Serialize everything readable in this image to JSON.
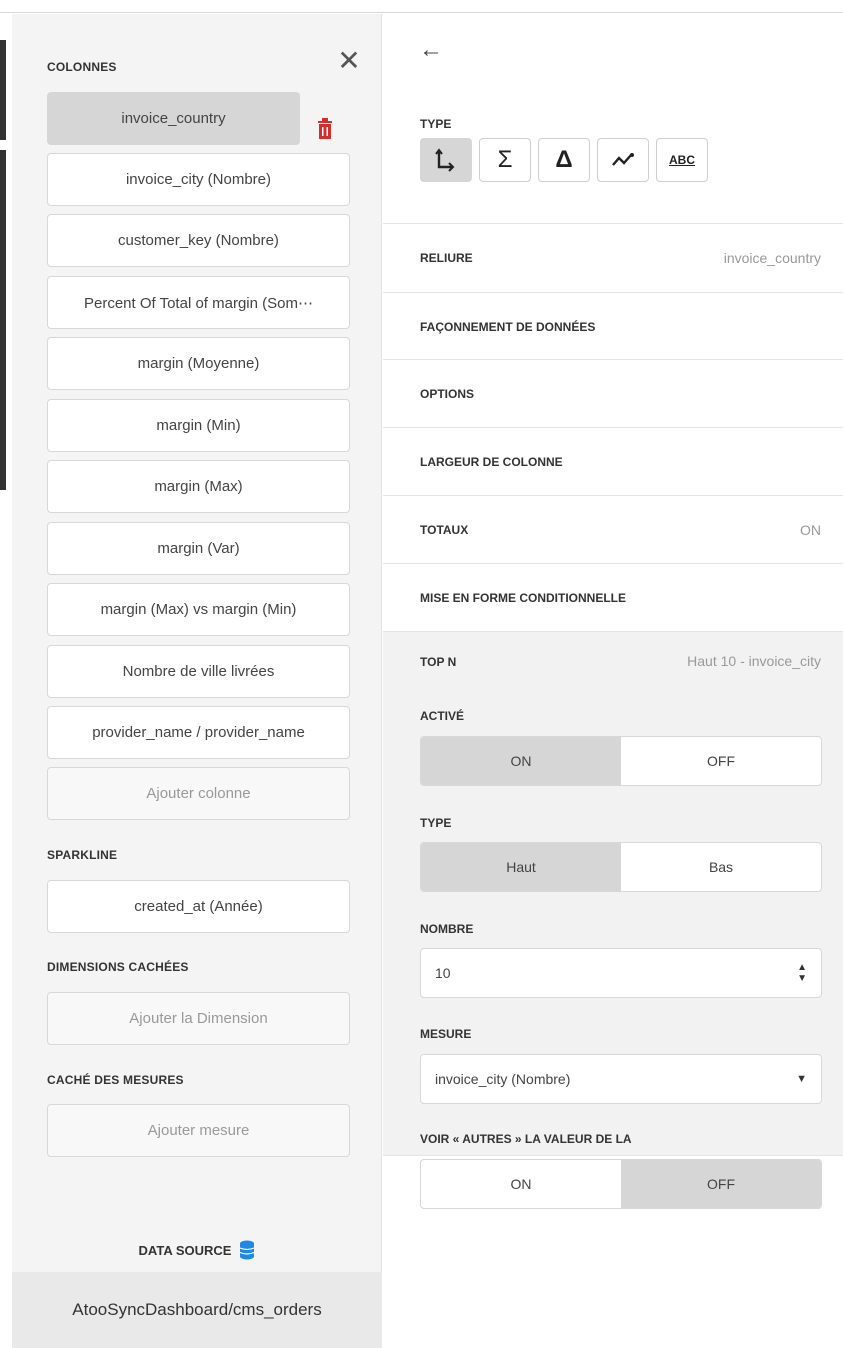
{
  "left": {
    "colonnes_label": "COLONNES",
    "columns": [
      "invoice_country",
      "invoice_city (Nombre)",
      "customer_key (Nombre)",
      "Percent Of Total of margin (Som⋯",
      "margin (Moyenne)",
      "margin (Min)",
      "margin (Max)",
      "margin (Var)",
      "margin (Max) vs margin (Min)",
      "Nombre de ville livrées",
      "provider_name / provider_name"
    ],
    "add_column": "Ajouter colonne",
    "sparkline_label": "SPARKLINE",
    "sparkline_value": "created_at (Année)",
    "hidden_dims_label": "DIMENSIONS CACHÉES",
    "add_dimension": "Ajouter la Dimension",
    "hidden_measures_label": "CACHÉ DES MESURES",
    "add_measure": "Ajouter mesure",
    "data_source_label": "DATA SOURCE",
    "connection": "AtooSyncDashboard/cms_orders"
  },
  "right": {
    "type_label": "TYPE",
    "type_buttons": [
      "⮤",
      "Σ",
      "Δ",
      "∿",
      "ABC"
    ],
    "binding_label": "RELIURE",
    "binding_value": "invoice_country",
    "data_shaping_label": "FAÇONNEMENT DE DONNÉES",
    "options_label": "OPTIONS",
    "col_width_label": "LARGEUR DE COLONNE",
    "totals_label": "TOTAUX",
    "totals_value": "ON",
    "cond_format_label": "MISE EN FORME CONDITIONNELLE",
    "topn": {
      "label": "TOP N",
      "value": "Haut 10 - invoice_city",
      "active_label": "ACTIVÉ",
      "active_on": "ON",
      "active_off": "OFF",
      "type_label": "TYPE",
      "type_top": "Haut",
      "type_bottom": "Bas",
      "number_label": "NOMBRE",
      "number_value": "10",
      "measure_label": "MESURE",
      "measure_value": "invoice_city (Nombre)",
      "others_label": "VOIR « AUTRES » LA VALEUR DE LA",
      "others_on": "ON",
      "others_off": "OFF"
    }
  },
  "colors": {
    "selected": "#d6d6d6",
    "trash": "#d32f2f",
    "db_icon": "#1e88e5"
  }
}
